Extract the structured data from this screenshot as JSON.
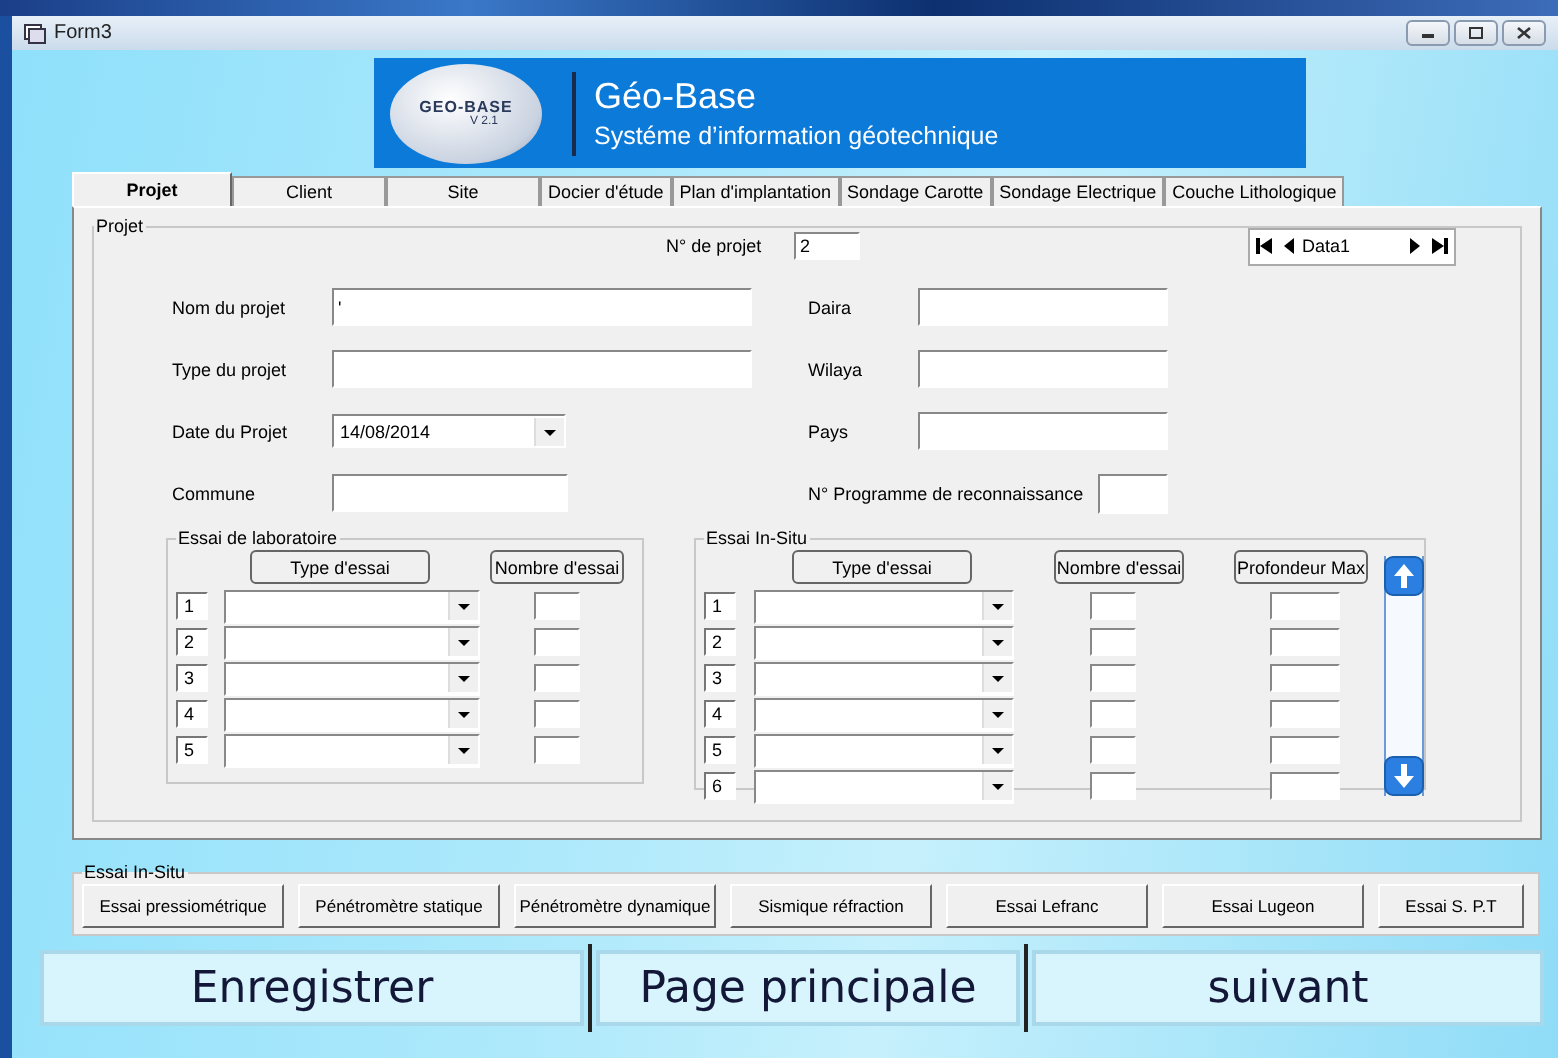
{
  "window": {
    "title": "Form3"
  },
  "banner": {
    "logo_text": "GEO-BASE",
    "logo_version": "V 2.1",
    "title": "Géo-Base",
    "subtitle": "Systéme d’information géotechnique"
  },
  "tabs": [
    {
      "label": "Projet",
      "selected": true
    },
    {
      "label": "Client",
      "selected": false
    },
    {
      "label": "Site",
      "selected": false
    },
    {
      "label": "Docier d'étude",
      "selected": false
    },
    {
      "label": "Plan d'implantation",
      "selected": false
    },
    {
      "label": "Sondage Carotte",
      "selected": false
    },
    {
      "label": "Sondage Electrique",
      "selected": false
    },
    {
      "label": "Couche Lithologique",
      "selected": false
    }
  ],
  "projet": {
    "legend": "Projet",
    "project_number": {
      "label": "N° de projet",
      "value": "2"
    },
    "navigator": {
      "caption": "Data1"
    },
    "left_fields": [
      {
        "label": "Nom du projet",
        "value": "'",
        "kind": "text"
      },
      {
        "label": "Type du projet",
        "kind": "text"
      },
      {
        "label": "Date du Projet",
        "value": "14/08/2014",
        "kind": "dropdown"
      },
      {
        "label": "Commune",
        "kind": "short"
      }
    ],
    "right_fields": [
      {
        "label": "Daira",
        "kind": "text"
      },
      {
        "label": "Wilaya",
        "kind": "text"
      },
      {
        "label": "Pays",
        "kind": "text"
      },
      {
        "label": "N° Programme de reconnaissance",
        "kind": "short"
      }
    ],
    "lab": {
      "legend": "Essai de laboratoire",
      "headers": [
        "Type d'essai",
        "Nombre d'essai"
      ],
      "rows": [
        "1",
        "2",
        "3",
        "4",
        "5"
      ]
    },
    "insitu": {
      "legend": "Essai In-Situ",
      "headers": [
        "Type d'essai",
        "Nombre d'essai",
        "Profondeur Max"
      ],
      "rows": [
        "1",
        "2",
        "3",
        "4",
        "5",
        "6"
      ]
    }
  },
  "bottom_group": {
    "legend": "Essai In-Situ",
    "buttons": [
      "Essai pressiométrique",
      "Pénétromètre statique",
      "Pénétromètre dynamique",
      "Sismique réfraction",
      "Essai  Lefranc",
      "Essai  Lugeon",
      "Essai  S. P.T"
    ]
  },
  "actions": [
    "Enregistrer",
    "Page principale",
    "suivant"
  ]
}
